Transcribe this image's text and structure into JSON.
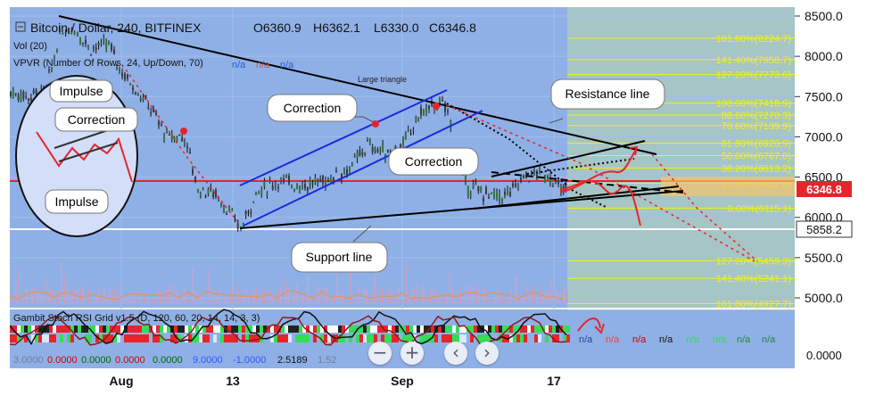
{
  "header": {
    "symbol_line": "Bitcoin / Dollar, 240, BITFINEX",
    "open": "O6360.9",
    "high": "H6362.1",
    "low": "L6330.0",
    "close": "C6346.8",
    "vol_label": "Vol (20)",
    "vpvr_label": "VPVR (Number Of Rows, 24, Up/Down, 70)",
    "na": "n/a"
  },
  "chart_data": {
    "type": "line",
    "title": "Bitcoin / Dollar, 240, BITFINEX",
    "price_axis": {
      "ticks": [
        8500,
        8000,
        7500,
        7000,
        6500,
        6000,
        5500,
        5000
      ],
      "tick_labels": [
        "8500.0",
        "8000.0",
        "7500.0",
        "7000.0",
        "6500.0",
        "6000.0",
        "5500.0",
        "5000.0"
      ],
      "current_price": "6346.8",
      "marked_price": "5858.2"
    },
    "x_axis": {
      "tick_labels": [
        "Aug",
        "13",
        "Sep",
        "17"
      ]
    },
    "fibonacci_levels": [
      {
        "label": "161.80%(8224.7)",
        "price": 8224.7
      },
      {
        "label": "141.40%(7958.7)",
        "price": 7958.7
      },
      {
        "label": "127.20%(7773.6)",
        "price": 7773.6
      },
      {
        "label": "100.00%(7418.9)",
        "price": 7418.9
      },
      {
        "label": "88.60%(7270.3)",
        "price": 7270.3
      },
      {
        "label": "78.60%(7139.9)",
        "price": 7139.9
      },
      {
        "label": "61.80%(6920.9)",
        "price": 6920.9
      },
      {
        "label": "50.00%(6767.0)",
        "price": 6767.0
      },
      {
        "label": "38.20%(6613.2)",
        "price": 6613.2
      },
      {
        "label": "23.60%(6422.8)",
        "price": 6422.8
      },
      {
        "label": "0.00%(6115.1)",
        "price": 6115.1
      },
      {
        "label": "127.20%(5459.3)",
        "price": 5459.3
      },
      {
        "label": "141.40%(5241.1)",
        "price": 5241.1
      },
      {
        "label": "161.80%(4927.7)",
        "price": 4927.7
      }
    ],
    "annotations": [
      "Impulse",
      "Correction",
      "Impulse",
      "Correction",
      "Correction",
      "Resistance line",
      "Support line",
      "Large triangle"
    ],
    "indicator": {
      "label": "Gambit Stoch RSI Grid v1.5 (D, 120, 60, 20, 14, 14, 3, 3)",
      "values": [
        "3.0000",
        "0.0000",
        "0.0000",
        "0.0000",
        "0.0000",
        "9.0000",
        "-1.0000",
        "2.5189",
        "1.52"
      ],
      "value_colors": [
        "#6f7f99",
        "#cc0000",
        "#006600",
        "#cc0000",
        "#006600",
        "#3355ff",
        "#3355ff",
        "#111111",
        "#6f7f99"
      ],
      "axis_label": "0.0000",
      "na_labels": [
        "n/a",
        "n/a",
        "n/a",
        "n/a",
        "n/a",
        "n/a",
        "n/a",
        "n/a"
      ],
      "na_colors": [
        "#224499",
        "#ff3b3b",
        "#cc0000",
        "#111111",
        "#33dd55",
        "#33dd55",
        "#228833",
        "#228833"
      ]
    },
    "grid": true
  },
  "controls": {
    "zoom_out": "−",
    "zoom_in": "+",
    "left": "‹",
    "right": "›"
  },
  "colors": {
    "background": "#8fb0e6",
    "projection": "#a8c8c2",
    "fib_text": "#f2f217",
    "price_label": "#e8242b"
  }
}
